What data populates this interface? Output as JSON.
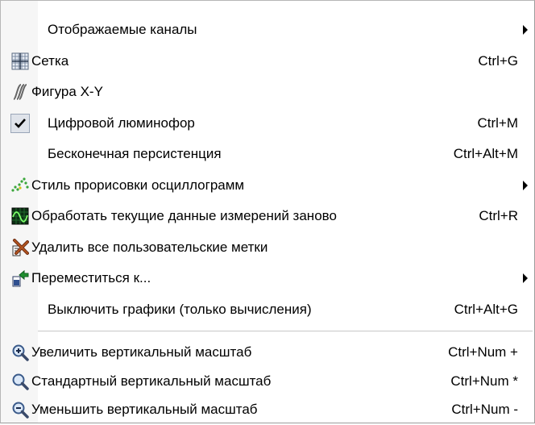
{
  "menu": {
    "items": [
      {
        "label": "Отображаемые каналы",
        "shortcut": "",
        "submenu": true,
        "icon": "none"
      },
      {
        "label": "Сетка",
        "shortcut": "Ctrl+G",
        "submenu": false,
        "icon": "grid-icon"
      },
      {
        "label": "Фигура X-Y",
        "shortcut": "",
        "submenu": false,
        "icon": "xy-figure-icon"
      },
      {
        "label": "Цифровой люминофор",
        "shortcut": "Ctrl+M",
        "submenu": false,
        "icon": "checkmark-icon",
        "checked": true
      },
      {
        "label": "Бесконечная персистенция",
        "shortcut": "Ctrl+Alt+M",
        "submenu": false,
        "icon": "none"
      },
      {
        "label": "Стиль прорисовки осциллограмм",
        "shortcut": "",
        "submenu": true,
        "icon": "waveform-style-icon"
      },
      {
        "label": "Обработать текущие данные измерений заново",
        "shortcut": "Ctrl+R",
        "submenu": false,
        "icon": "reprocess-icon"
      },
      {
        "label": "Удалить все пользовательские метки",
        "shortcut": "",
        "submenu": false,
        "icon": "delete-markers-icon"
      },
      {
        "label": "Переместиться к...",
        "shortcut": "",
        "submenu": true,
        "icon": "goto-icon"
      },
      {
        "label": "Выключить графики (только вычисления)",
        "shortcut": "Ctrl+Alt+G",
        "submenu": false,
        "icon": "none"
      }
    ],
    "zoom_items": [
      {
        "label": "Увеличить вертикальный масштаб",
        "shortcut": "Ctrl+Num +",
        "icon": "zoom-in-icon"
      },
      {
        "label": "Стандартный вертикальный масштаб",
        "shortcut": "Ctrl+Num *",
        "icon": "zoom-default-icon"
      },
      {
        "label": "Уменьшить вертикальный масштаб",
        "shortcut": "Ctrl+Num -",
        "icon": "zoom-out-icon"
      }
    ]
  }
}
